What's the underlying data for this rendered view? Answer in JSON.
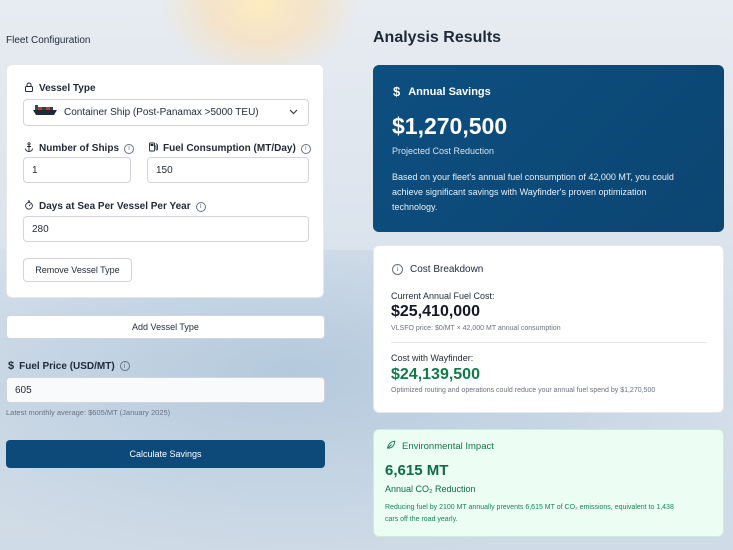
{
  "fleet": {
    "title": "Fleet Configuration",
    "vessel_type_label": "Vessel Type",
    "vessel_type_value": "Container Ship (Post-Panamax >5000 TEU)",
    "num_ships_label": "Number of Ships",
    "num_ships_value": "1",
    "fuel_consumption_label": "Fuel Consumption (MT/Day)",
    "fuel_consumption_value": "150",
    "days_label": "Days at Sea Per Vessel Per Year",
    "days_value": "280",
    "remove_label": "Remove Vessel Type",
    "add_label": "Add Vessel Type",
    "fuel_price_label": "Fuel Price (USD/MT)",
    "fuel_price_value": "605",
    "fuel_price_hint": "Latest monthly average: $605/MT (January 2025)",
    "calculate_label": "Calculate Savings"
  },
  "results": {
    "title": "Analysis Results",
    "savings": {
      "heading": "Annual Savings",
      "amount": "$1,270,500",
      "subtitle": "Projected Cost Reduction",
      "description_line1": "Based on your fleet's annual fuel consumption of 42,000 MT, you could",
      "description_line2": "achieve significant savings with Wayfinder's proven optimization",
      "description_line3": "technology."
    },
    "breakdown": {
      "heading": "Cost Breakdown",
      "current_label": "Current Annual Fuel Cost:",
      "current_value": "$25,410,000",
      "current_note": "VLSFO price: $0/MT × 42,000 MT annual consumption",
      "wayfinder_label": "Cost with Wayfinder:",
      "wayfinder_value": "$24,139,500",
      "wayfinder_note": "Optimized routing and operations could reduce your annual fuel spend by $1,270,500"
    },
    "environment": {
      "heading": "Environmental Impact",
      "amount": "6,615 MT",
      "subtitle": "Annual CO₂ Reduction",
      "description_line1": "Reducing fuel by 2100 MT annually prevents 6,615 MT of CO₂ emissions, equivalent to 1,438",
      "description_line2": "cars off the road yearly."
    }
  },
  "colors": {
    "primary": "#0d4a7a",
    "green": "#0f7a4a",
    "green_bg": "#ecfdf3"
  },
  "icons": {
    "vessel": "lock-icon",
    "ship": "ship-icon",
    "anchor": "anchor-icon",
    "fuel": "fuel-pump-icon",
    "timer": "stopwatch-icon",
    "dollar": "dollar-icon",
    "info": "info-icon",
    "leaf": "leaf-icon"
  }
}
